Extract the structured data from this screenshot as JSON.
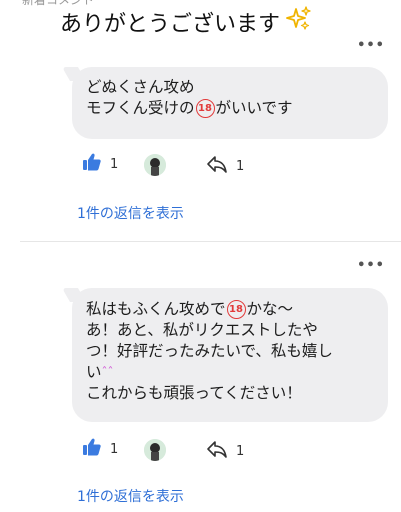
{
  "header": {
    "section_label": "新着コメント",
    "caption": "ありがとうございます",
    "sparkle_icon": "sparkle-icon"
  },
  "comments": [
    {
      "more_label": "•••",
      "lines": [
        {
          "text": "どぬくさん攻め"
        },
        {
          "before": "モフくん受けの",
          "badge": "18",
          "after": "がいいです"
        }
      ],
      "likes": "1",
      "replies": "1",
      "replies_link": "1件の返信を表示"
    },
    {
      "more_label": "•••",
      "lines": [
        {
          "before": "私はもふくん攻めで",
          "badge": "18",
          "after": "かな〜"
        },
        {
          "text": "あ！あと、私がリクエストしたや"
        },
        {
          "text": "つ！好評だったみたいで、私も嬉し"
        },
        {
          "text": "い",
          "emoji": "ˆˆ"
        },
        {
          "text": "これからも頑張ってください！"
        }
      ],
      "likes": "1",
      "replies": "1",
      "replies_link": "1件の返信を表示"
    }
  ],
  "colors": {
    "accent": "#2f6fd6",
    "like_icon": "#3b7be0",
    "bubble": "#eeeef0",
    "r18_badge": "#e23a3a",
    "sparkle": "#f0b400"
  }
}
